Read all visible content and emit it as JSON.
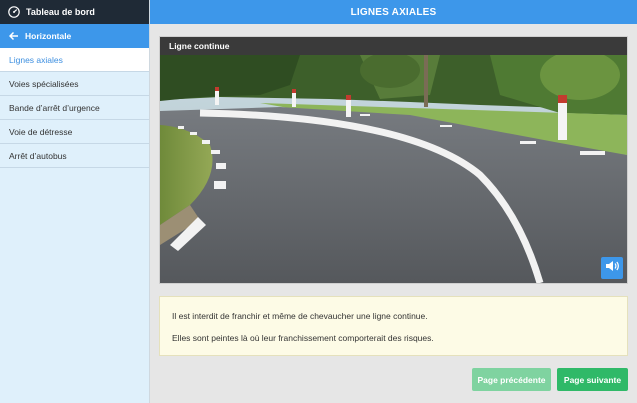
{
  "sidebar": {
    "dashboard_label": "Tableau de bord",
    "back_label": "Horizontale",
    "items": [
      {
        "label": "Lignes axiales",
        "active": true
      },
      {
        "label": "Voies spécialisées",
        "active": false
      },
      {
        "label": "Bande d’arrêt d’urgence",
        "active": false
      },
      {
        "label": "Voie de détresse",
        "active": false
      },
      {
        "label": "Arrêt d’autobus",
        "active": false
      }
    ]
  },
  "header": {
    "title": "LIGNES AXIALES"
  },
  "card": {
    "title": "Ligne continue",
    "sound_icon": "speaker-icon"
  },
  "explanation": {
    "line1": "Il est interdit de franchir et même de chevaucher une ligne continue.",
    "line2": "Elles sont peintes là où leur franchissement comporterait des risques."
  },
  "navigation": {
    "prev_label": "Page précédente",
    "next_label": "Page suivante"
  },
  "colors": {
    "accent": "#3d97ea",
    "dark": "#1f2a36",
    "success": "#2fb968",
    "success_light": "#7fd3a0"
  }
}
